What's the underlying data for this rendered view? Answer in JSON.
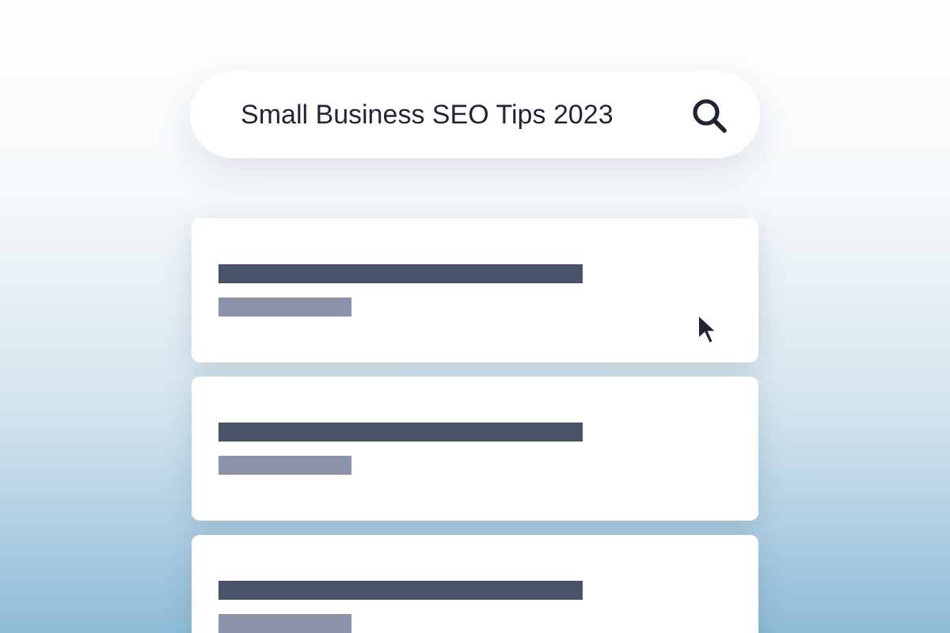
{
  "search": {
    "value": "Small Business SEO Tips 2023"
  },
  "results": [
    {
      "kind": "skeleton"
    },
    {
      "kind": "skeleton"
    },
    {
      "kind": "skeleton"
    }
  ]
}
